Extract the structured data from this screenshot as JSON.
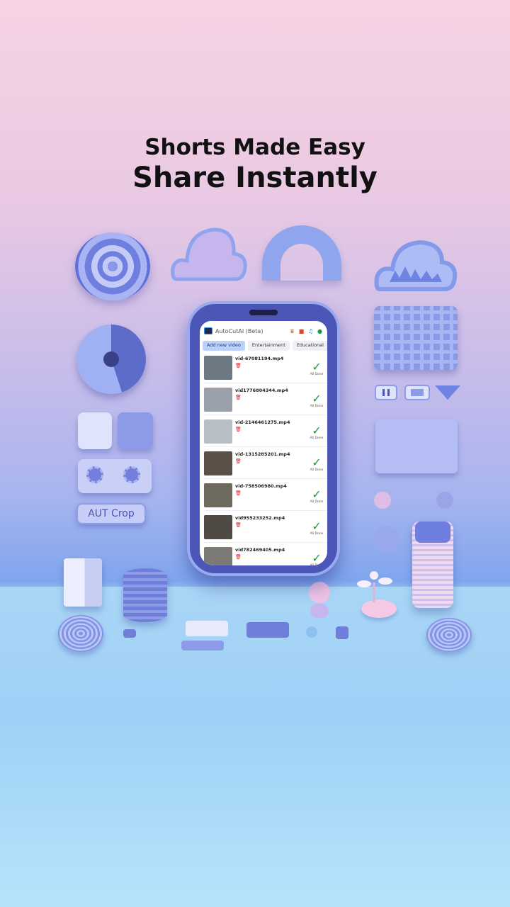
{
  "headline": {
    "line1": "Shorts Made Easy",
    "line2": "Share Instantly"
  },
  "deco": {
    "crop_label": "AUT Crop"
  },
  "app": {
    "title": "AutoCutAI (Beta)",
    "tabs": [
      "Add new video",
      "Entertainment",
      "Educational"
    ],
    "videos": [
      {
        "filename": "vid-67081194.mp4",
        "status": "All Done",
        "thumb_color": "#6d7a84"
      },
      {
        "filename": "vid1776804344.mp4",
        "status": "All Done",
        "thumb_color": "#9aa1aa"
      },
      {
        "filename": "vid-2146461275.mp4",
        "status": "All Done",
        "thumb_color": "#b9bfc6"
      },
      {
        "filename": "vid-1315285201.mp4",
        "status": "All Done",
        "thumb_color": "#5b5148"
      },
      {
        "filename": "vid-758506980.mp4",
        "status": "All Done",
        "thumb_color": "#6f6a5e"
      },
      {
        "filename": "vid955233252.mp4",
        "status": "All Done",
        "thumb_color": "#4f4a44"
      },
      {
        "filename": "vid782469405.mp4",
        "status": "All Done",
        "thumb_color": "#7b7a74"
      }
    ]
  },
  "colors": {
    "check": "#1c9a3c",
    "trash": "#d6262a",
    "active_tab": "#bcd1f6"
  }
}
